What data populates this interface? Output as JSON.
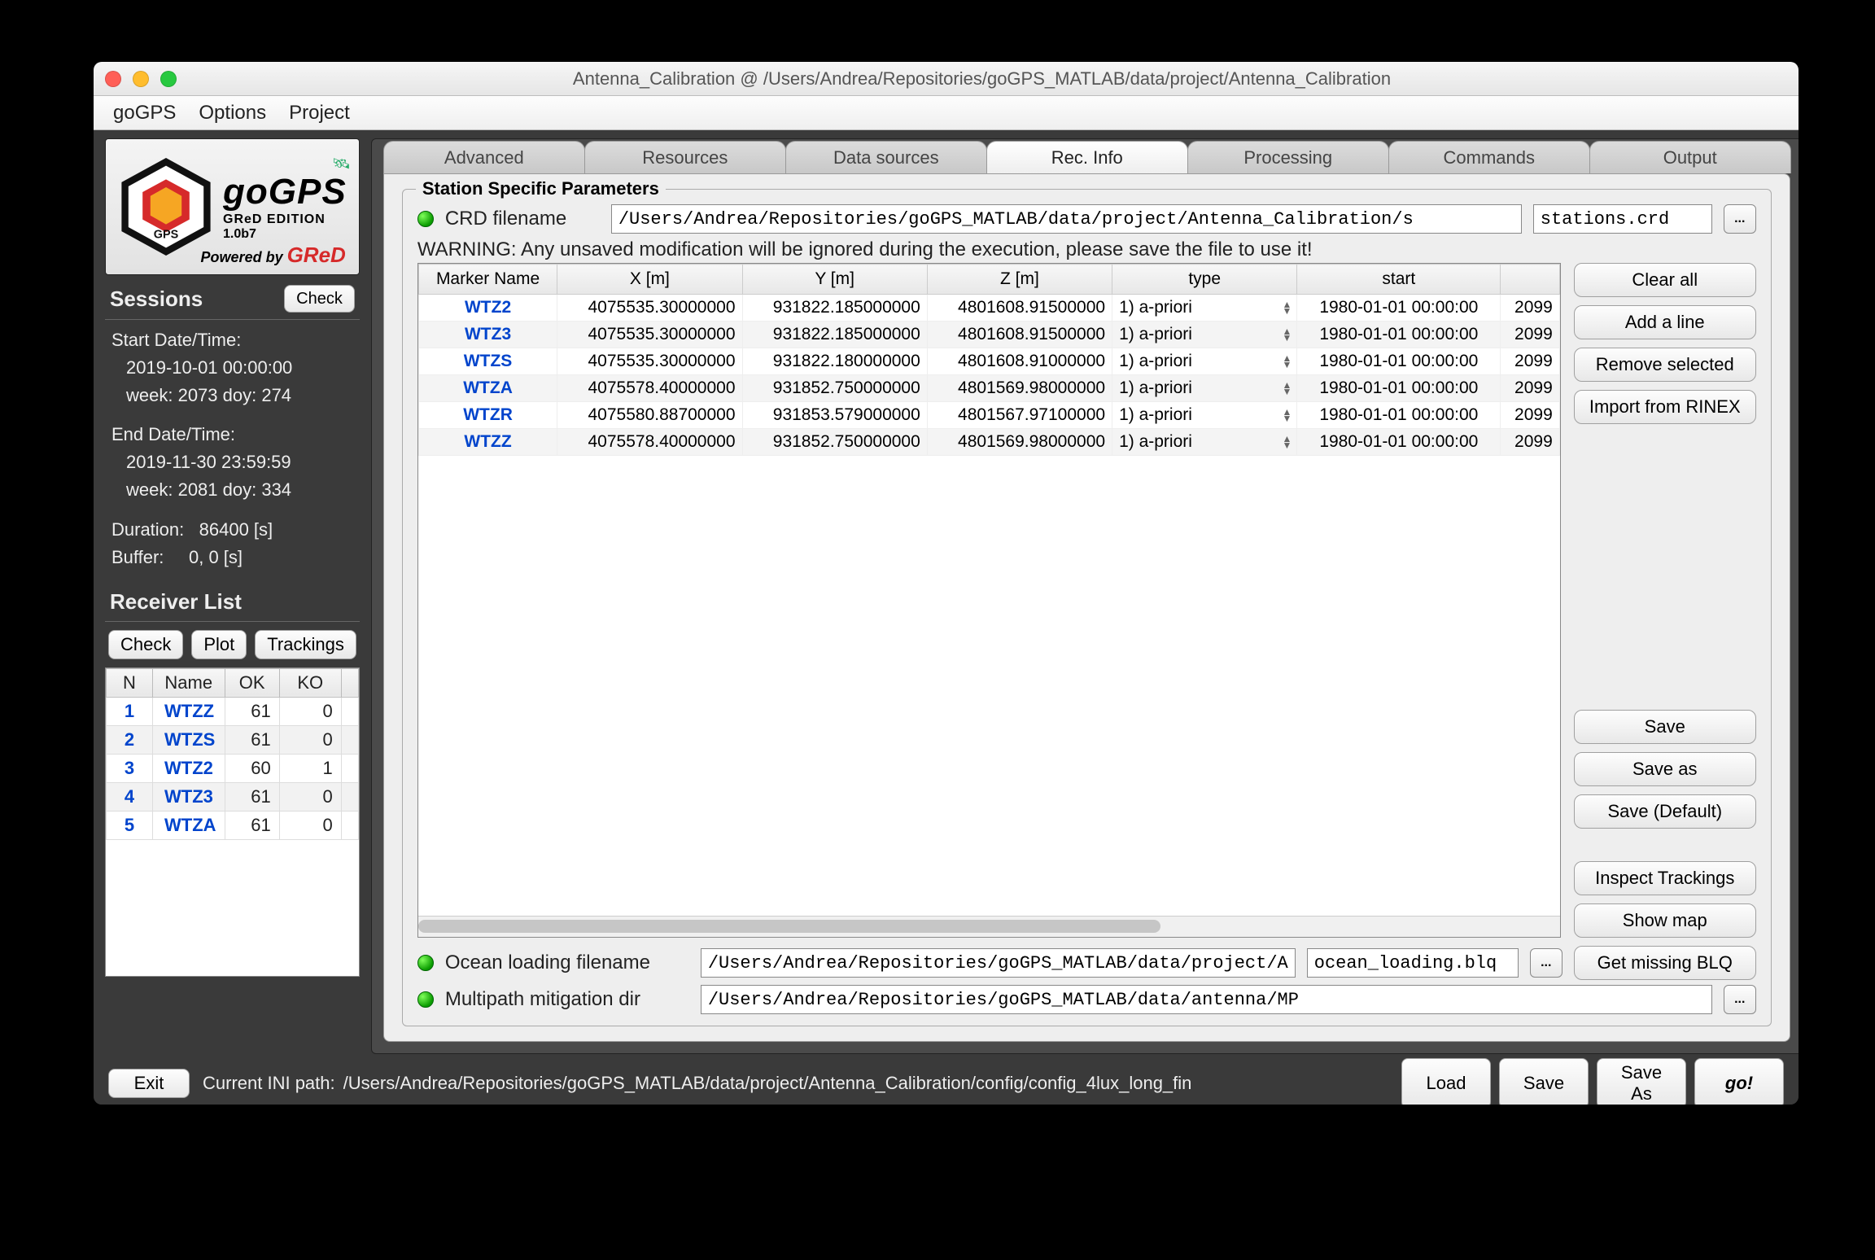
{
  "window": {
    "title": "Antenna_Calibration @ /Users/Andrea/Repositories/goGPS_MATLAB/data/project/Antenna_Calibration"
  },
  "menu": {
    "items": [
      "goGPS",
      "Options",
      "Project"
    ]
  },
  "logo": {
    "title": "goGPS",
    "subtitle": "GReD EDITION",
    "version": "1.0b7",
    "powered_prefix": "Powered by ",
    "powered_brand": "GReD"
  },
  "sessions": {
    "title": "Sessions",
    "check_label": "Check",
    "start_label": "Start Date/Time:",
    "start_value": "2019-10-01  00:00:00",
    "start_week": "week: 2073 doy: 274",
    "end_label": "End Date/Time:",
    "end_value": "2019-11-30  23:59:59",
    "end_week": "week: 2081 doy: 334",
    "duration_label": "Duration:",
    "duration_value": "86400 [s]",
    "buffer_label": "Buffer:",
    "buffer_value": "0,     0 [s]"
  },
  "receivers": {
    "title": "Receiver List",
    "btn_check": "Check",
    "btn_plot": "Plot",
    "btn_trackings": "Trackings",
    "headers": {
      "n": "N",
      "name": "Name",
      "ok": "OK",
      "ko": "KO"
    },
    "rows": [
      {
        "n": "1",
        "name": "WTZZ",
        "ok": "61",
        "ko": "0"
      },
      {
        "n": "2",
        "name": "WTZS",
        "ok": "61",
        "ko": "0"
      },
      {
        "n": "3",
        "name": "WTZ2",
        "ok": "60",
        "ko": "1"
      },
      {
        "n": "4",
        "name": "WTZ3",
        "ok": "61",
        "ko": "0"
      },
      {
        "n": "5",
        "name": "WTZA",
        "ok": "61",
        "ko": "0"
      }
    ]
  },
  "tabs": {
    "items": [
      "Advanced",
      "Resources",
      "Data sources",
      "Rec. Info",
      "Processing",
      "Commands",
      "Output"
    ],
    "active_index": 3
  },
  "station": {
    "group_title": "Station Specific Parameters",
    "crd_label": "CRD filename",
    "crd_path": "/Users/Andrea/Repositories/goGPS_MATLAB/data/project/Antenna_Calibration/s",
    "crd_file": "stations.crd",
    "browse": "...",
    "warning": "WARNING: Any unsaved modification will be ignored during the execution, please save the file to use it!",
    "headers": {
      "marker": "Marker Name",
      "x": "X [m]",
      "y": "Y [m]",
      "z": "Z [m]",
      "type": "type",
      "start": "start",
      "end_partial": ""
    },
    "rows": [
      {
        "marker": "WTZ2",
        "x": "4075535.30000000",
        "y": "931822.185000000",
        "z": "4801608.91500000",
        "type": "1) a-priori",
        "start": "1980-01-01 00:00:00",
        "end": "2099"
      },
      {
        "marker": "WTZ3",
        "x": "4075535.30000000",
        "y": "931822.185000000",
        "z": "4801608.91500000",
        "type": "1) a-priori",
        "start": "1980-01-01 00:00:00",
        "end": "2099"
      },
      {
        "marker": "WTZS",
        "x": "4075535.30000000",
        "y": "931822.180000000",
        "z": "4801608.91000000",
        "type": "1) a-priori",
        "start": "1980-01-01 00:00:00",
        "end": "2099"
      },
      {
        "marker": "WTZA",
        "x": "4075578.40000000",
        "y": "931852.750000000",
        "z": "4801569.98000000",
        "type": "1) a-priori",
        "start": "1980-01-01 00:00:00",
        "end": "2099"
      },
      {
        "marker": "WTZR",
        "x": "4075580.88700000",
        "y": "931853.579000000",
        "z": "4801567.97100000",
        "type": "1) a-priori",
        "start": "1980-01-01 00:00:00",
        "end": "2099"
      },
      {
        "marker": "WTZZ",
        "x": "4075578.40000000",
        "y": "931852.750000000",
        "z": "4801569.98000000",
        "type": "1) a-priori",
        "start": "1980-01-01 00:00:00",
        "end": "2099"
      }
    ],
    "actions": {
      "clear_all": "Clear all",
      "add_line": "Add a line",
      "remove_sel": "Remove selected",
      "import_rinex": "Import from RINEX",
      "save": "Save",
      "save_as": "Save as",
      "save_default": "Save (Default)",
      "inspect": "Inspect Trackings",
      "show_map": "Show map"
    },
    "ocean_label": "Ocean loading filename",
    "ocean_path": "/Users/Andrea/Repositories/goGPS_MATLAB/data/project/A",
    "ocean_file": "ocean_loading.blq",
    "ocean_btn": "Get missing BLQ",
    "mp_label": "Multipath mitigation dir",
    "mp_path": "/Users/Andrea/Repositories/goGPS_MATLAB/data/antenna/MP"
  },
  "footer": {
    "exit": "Exit",
    "ini_label": "Current INI path:",
    "ini_path": "/Users/Andrea/Repositories/goGPS_MATLAB/data/project/Antenna_Calibration/config/config_4lux_long_fin",
    "load": "Load",
    "save": "Save",
    "save_as": "Save As",
    "go": "go!"
  }
}
